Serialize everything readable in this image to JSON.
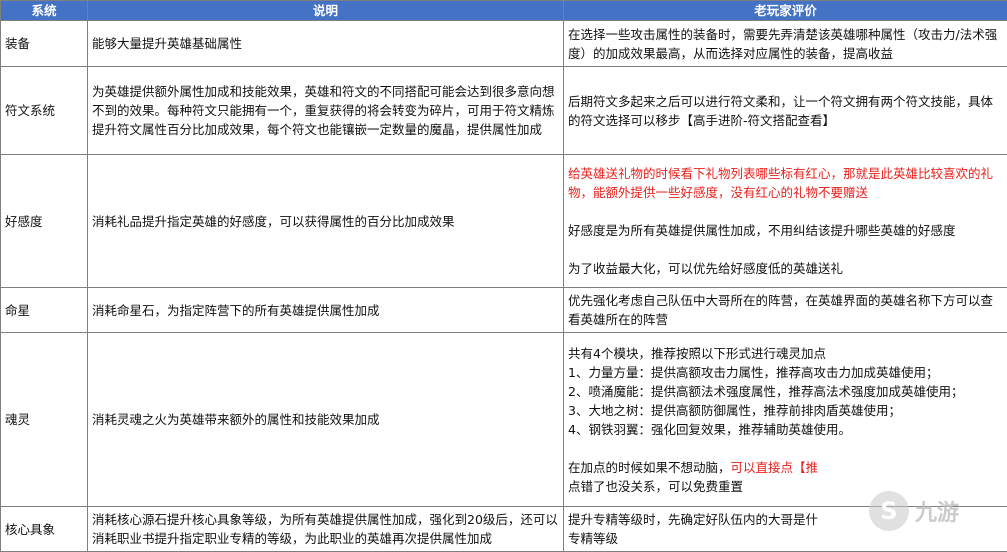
{
  "headers": {
    "system": "系统",
    "description": "说明",
    "review": "老玩家评价"
  },
  "rows": [
    {
      "system": "装备",
      "description": "能够大量提升英雄基础属性",
      "review": [
        "在选择一些攻击属性的装备时，需要先弄清楚该英雄哪种属性（攻击力/法术强度）的加成效果最高，从而选择对应属性的装备，提高收益"
      ]
    },
    {
      "system": "符文系统",
      "description": "为英雄提供额外属性加成和技能效果，英雄和符文的不同搭配可能会达到很多意向想不到的效果。每种符文只能拥有一个，重复获得的将会转变为碎片，可用于符文精炼提升符文属性百分比加成效果，每个符文也能镶嵌一定数量的魔晶，提供属性加成",
      "review": [
        "后期符文多起来之后可以进行符文柔和，让一个符文拥有两个符文技能，具体的符文选择可以移步【高手进阶-符文搭配查看】"
      ]
    },
    {
      "system": "好感度",
      "description": "消耗礼品提升指定英雄的好感度，可以获得属性的百分比加成效果",
      "review_red": "给英雄送礼物的时候看下礼物列表哪些标有红心，那就是此英雄比较喜欢的礼物，能额外提供一些好感度，没有红心的礼物不要赠送",
      "review": [
        "好感度是为所有英雄提供属性加成，不用纠结该提升哪些英雄的好感度",
        "为了收益最大化，可以优先给好感度低的英雄送礼"
      ]
    },
    {
      "system": "命星",
      "description": "消耗命星石，为指定阵营下的所有英雄提供属性加成",
      "review": [
        "优先强化考虑自己队伍中大哥所在的阵营，在英雄界面的英雄名称下方可以查看英雄所在的阵营"
      ]
    },
    {
      "system": "魂灵",
      "description": "消耗灵魂之火为英雄带来额外的属性和技能效果加成",
      "review": [
        "共有4个模块，推荐按照以下形式进行魂灵加点",
        "1、力量方量：提供高额攻击力属性，推荐高攻击力加成英雄使用；",
        "2、喷涌魔能：提供高额法术强度属性，推荐高法术强度加成英雄使用；",
        "3、大地之树：提供高额防御属性，推荐前排肉盾英雄使用；",
        "4、钢铁羽翼：强化回复效果，推荐辅助英雄使用。"
      ],
      "review_tail_a": "在加点的时候如果不想动脑，",
      "review_tail_red": "可以直接点【推",
      "review_tail_b": "点错了也没关系，可以免费重置"
    },
    {
      "system": "核心具象",
      "description": "消耗核心源石提升核心具象等级，为所有英雄提供属性加成，强化到20级后，还可以消耗职业书提升指定职业专精的等级，为此职业的英雄再次提供属性加成",
      "review": [
        "提升专精等级时，先确定好队伍内的大哥是什",
        "专精等级"
      ]
    }
  ],
  "watermark": {
    "logo_text": "九游"
  }
}
